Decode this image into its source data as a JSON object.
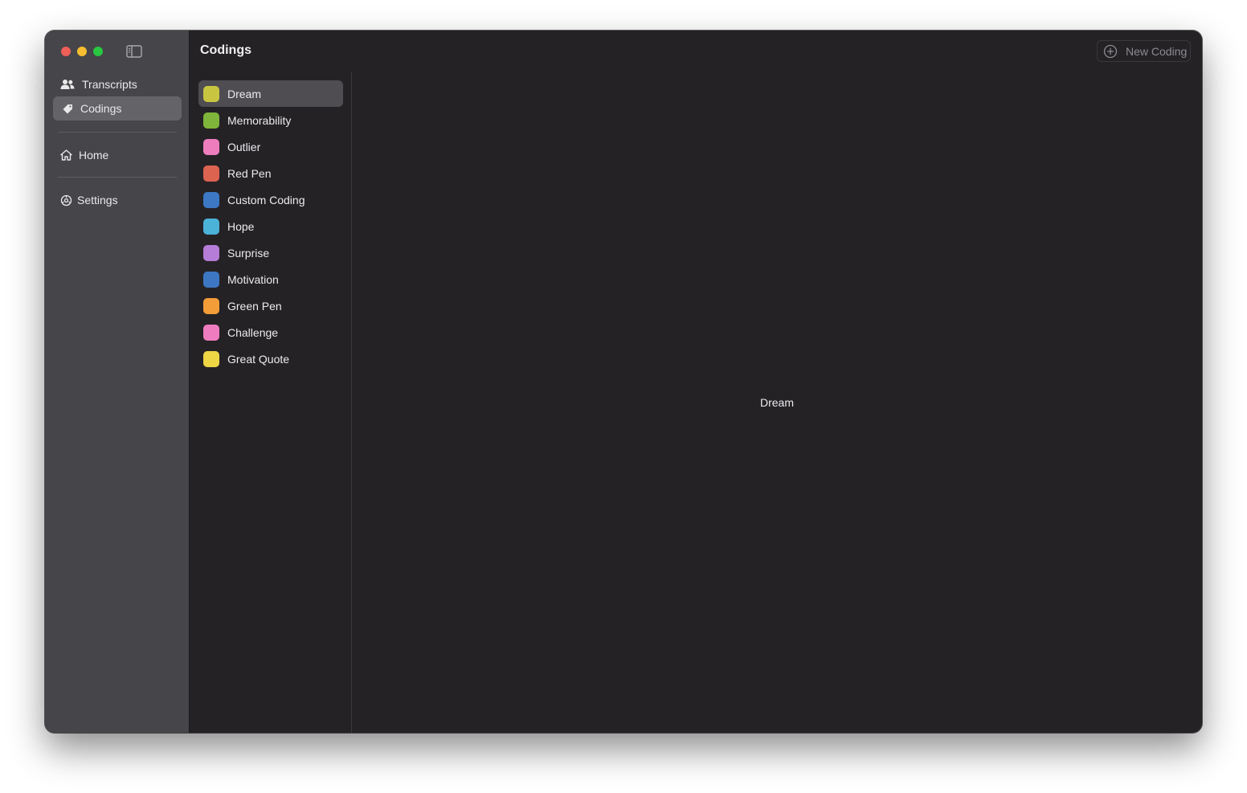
{
  "window": {
    "title": "Codings"
  },
  "sidebar": {
    "items": [
      {
        "label": "Transcripts",
        "icon": "people-icon"
      },
      {
        "label": "Codings",
        "icon": "tag-icon",
        "selected": true
      },
      {
        "label": "Home",
        "icon": "house-icon"
      },
      {
        "label": "Settings",
        "icon": "gear-icon"
      }
    ]
  },
  "toolbar": {
    "new_coding_label": "New Coding",
    "new_coding_icon": "plus-circle-icon"
  },
  "codings": [
    {
      "label": "Dream",
      "color": "#c8c641",
      "selected": true
    },
    {
      "label": "Memorability",
      "color": "#7eb53a"
    },
    {
      "label": "Outlier",
      "color": "#ee7dbe"
    },
    {
      "label": "Red Pen",
      "color": "#dd6351"
    },
    {
      "label": "Custom Coding",
      "color": "#3c78c4"
    },
    {
      "label": "Hope",
      "color": "#4bb2d8"
    },
    {
      "label": "Surprise",
      "color": "#b57cd8"
    },
    {
      "label": "Motivation",
      "color": "#3d77c4"
    },
    {
      "label": "Green Pen",
      "color": "#f39d39"
    },
    {
      "label": "Challenge",
      "color": "#ef7cbf"
    },
    {
      "label": "Great Quote",
      "color": "#eed645"
    }
  ],
  "detail": {
    "label": "Dream"
  }
}
